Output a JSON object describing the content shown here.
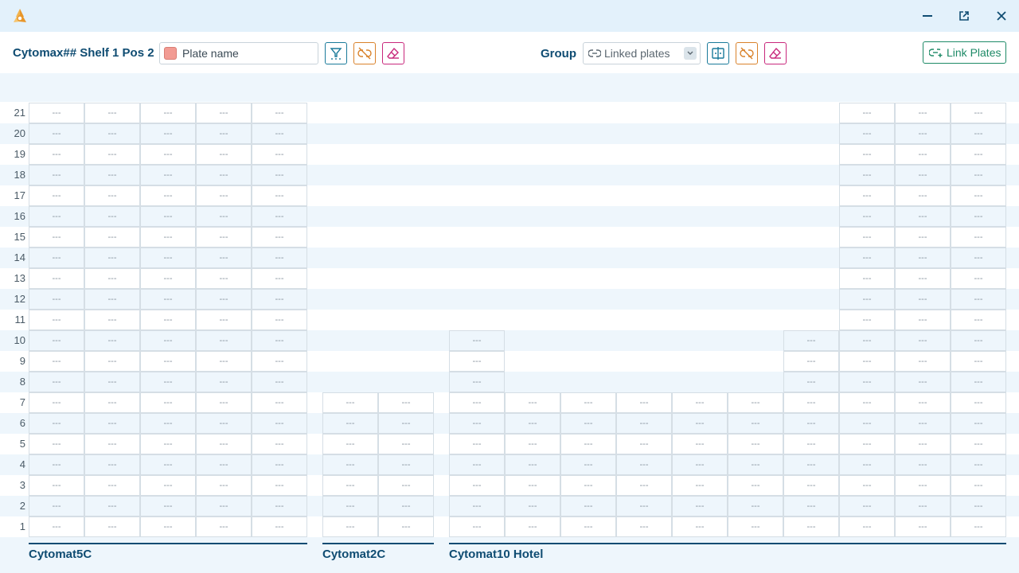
{
  "toolbar": {
    "plate_title": "Cytomax## Shelf 1 Pos 2",
    "plate_name_placeholder": "Plate name",
    "group_label": "Group",
    "group_select_value": "Linked plates",
    "link_plates_label": "Link Plates"
  },
  "colors": {
    "accent": "#0f4c72",
    "teal": "#1a7a9a",
    "orange": "#d9822b",
    "pink": "#c8287c",
    "green": "#1e8a67",
    "plate_swatch": "#f29b93"
  },
  "empty_slot_label": "---",
  "rows": [
    "21",
    "20",
    "19",
    "18",
    "17",
    "16",
    "15",
    "14",
    "13",
    "12",
    "11",
    "10",
    "9",
    "8",
    "7",
    "6",
    "5",
    "4",
    "3",
    "2",
    "1"
  ],
  "devices": [
    {
      "name": "Cytomat5C",
      "stacks": [
        21,
        21,
        21,
        21,
        21
      ]
    },
    {
      "name": "Cytomat2C",
      "stacks": [
        7,
        7
      ]
    },
    {
      "name": "Cytomat10 Hotel",
      "stacks": [
        10,
        7,
        7,
        7,
        7,
        7,
        10,
        21,
        21,
        21
      ]
    }
  ]
}
